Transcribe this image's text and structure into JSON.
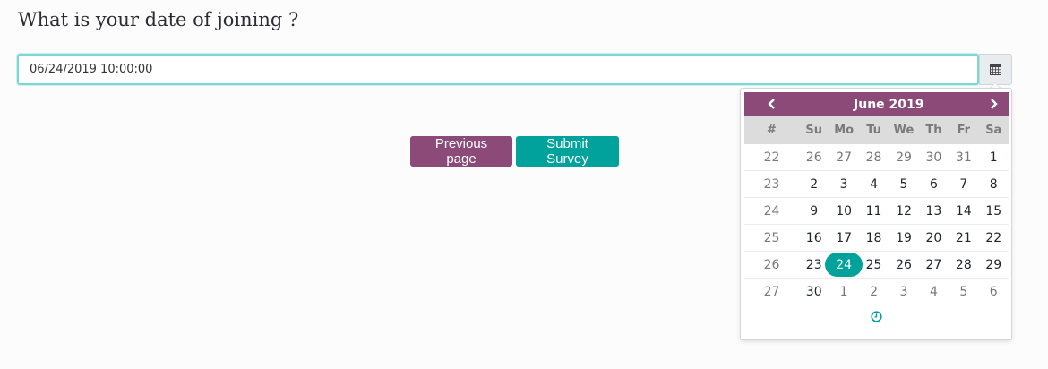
{
  "question": "What is your date of joining ?",
  "date_input": {
    "value": "06/24/2019 10:00:00"
  },
  "buttons": {
    "previous_label": "Previous page",
    "submit_label": "Submit Survey"
  },
  "calendar": {
    "month_label": "June 2019",
    "prev_glyph": "‹",
    "next_glyph": "›",
    "week_header": "#",
    "weekdays": [
      "Su",
      "Mo",
      "Tu",
      "We",
      "Th",
      "Fr",
      "Sa"
    ],
    "weeks": [
      {
        "num": "22",
        "days": [
          "26",
          "27",
          "28",
          "29",
          "30",
          "31",
          "1"
        ]
      },
      {
        "num": "23",
        "days": [
          "2",
          "3",
          "4",
          "5",
          "6",
          "7",
          "8"
        ]
      },
      {
        "num": "24",
        "days": [
          "9",
          "10",
          "11",
          "12",
          "13",
          "14",
          "15"
        ]
      },
      {
        "num": "25",
        "days": [
          "16",
          "17",
          "18",
          "19",
          "20",
          "21",
          "22"
        ]
      },
      {
        "num": "26",
        "days": [
          "23",
          "24",
          "25",
          "26",
          "27",
          "28",
          "29"
        ]
      },
      {
        "num": "27",
        "days": [
          "30",
          "1",
          "2",
          "3",
          "4",
          "5",
          "6"
        ]
      }
    ],
    "selected_day": "24",
    "accent_color": "#01a29c",
    "header_color": "#8b4a78"
  },
  "icons": {
    "calendar_toggle": "calendar-icon",
    "time_picker": "clock-icon"
  }
}
